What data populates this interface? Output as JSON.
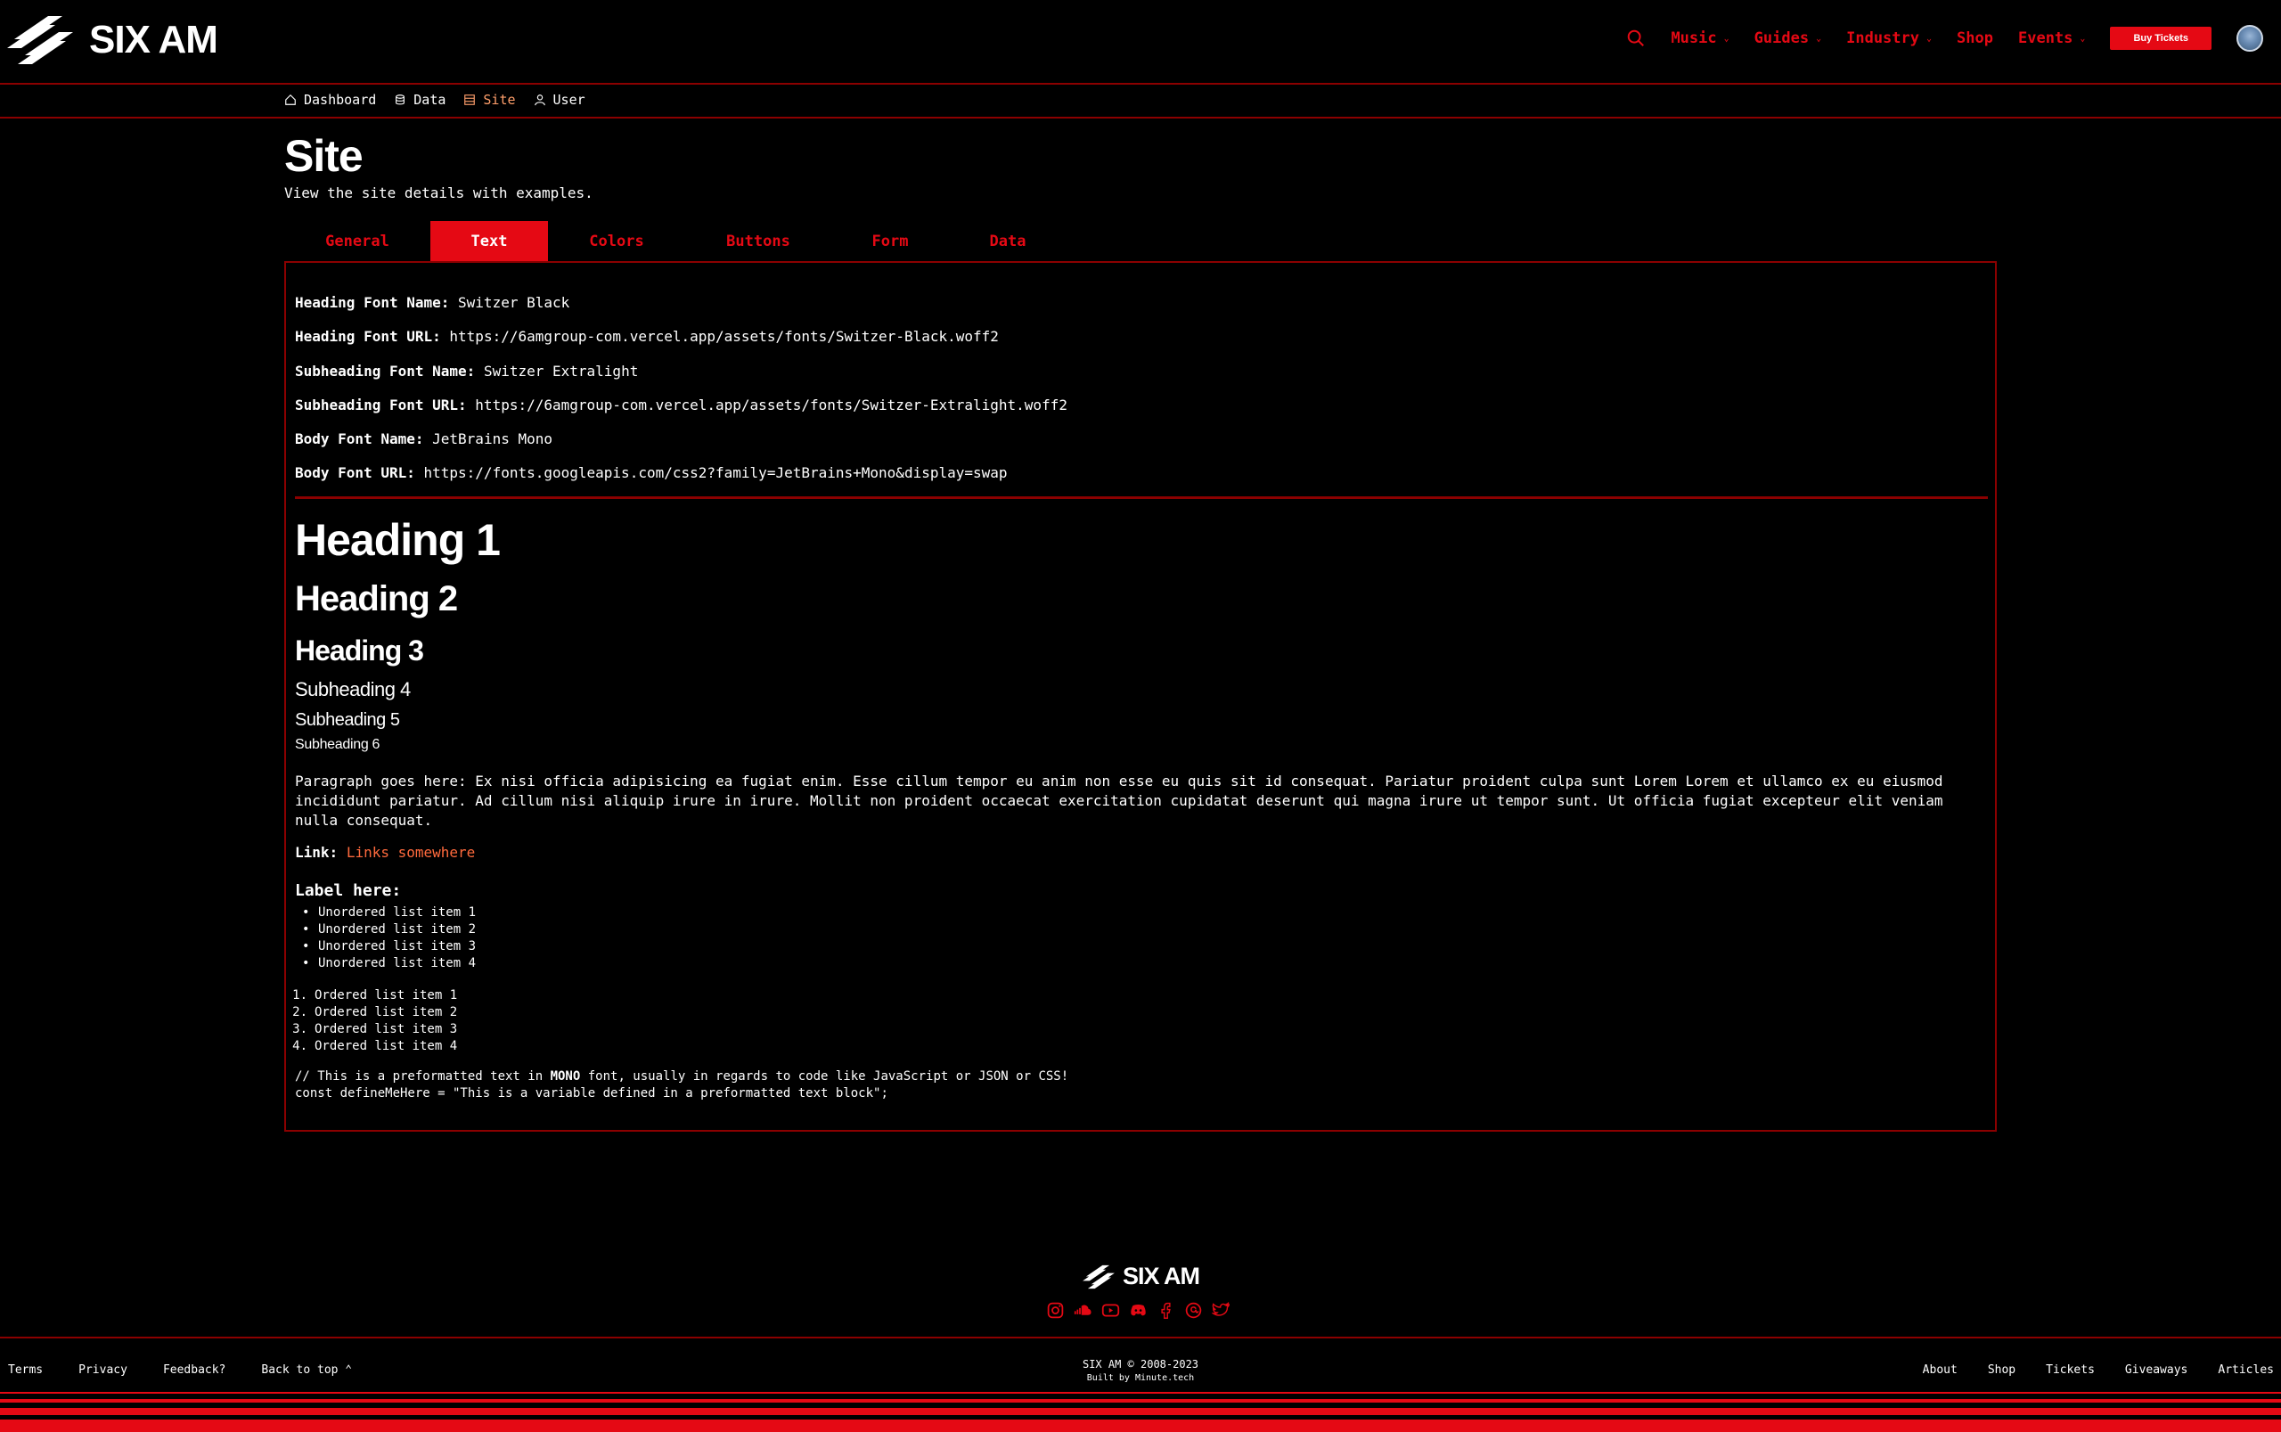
{
  "brand": {
    "name": "SIX AM",
    "accent": "#e50914",
    "border": "#8b0000",
    "link": "#ff6a3d"
  },
  "nav": {
    "search_icon": "search-icon",
    "items": [
      {
        "label": "Music",
        "caret": "⌄"
      },
      {
        "label": "Guides",
        "caret": "⌄"
      },
      {
        "label": "Industry",
        "caret": "⌄"
      },
      {
        "label": "Shop"
      },
      {
        "label": "Events",
        "caret": "⌄"
      }
    ],
    "buy_label": "Buy Tickets"
  },
  "breadcrumb": [
    {
      "label": "Dashboard",
      "icon": "home-icon"
    },
    {
      "label": "Data",
      "icon": "database-icon"
    },
    {
      "label": "Site",
      "icon": "layout-icon"
    },
    {
      "label": "User",
      "icon": "user-icon"
    }
  ],
  "page": {
    "title": "Site",
    "subtitle": "View the site details with examples."
  },
  "tabs": [
    {
      "label": "General"
    },
    {
      "label": "Text"
    },
    {
      "label": "Colors"
    },
    {
      "label": "Buttons"
    },
    {
      "label": "Form"
    },
    {
      "label": "Data"
    }
  ],
  "fonts": [
    {
      "key": "Heading Font Name:",
      "value": "Switzer Black"
    },
    {
      "key": "Heading Font URL:",
      "value": "https://6amgroup-com.vercel.app/assets/fonts/Switzer-Black.woff2"
    },
    {
      "key": "Subheading Font Name:",
      "value": "Switzer Extralight"
    },
    {
      "key": "Subheading Font URL:",
      "value": "https://6amgroup-com.vercel.app/assets/fonts/Switzer-Extralight.woff2"
    },
    {
      "key": "Body Font Name:",
      "value": "JetBrains Mono"
    },
    {
      "key": "Body Font URL:",
      "value": "https://fonts.googleapis.com/css2?family=JetBrains+Mono&display=swap"
    }
  ],
  "samples": {
    "h1": "Heading 1",
    "h2": "Heading 2",
    "h3": "Heading 3",
    "sh4": "Subheading 4",
    "sh5": "Subheading 5",
    "sh6": "Subheading 6",
    "paragraph": "Paragraph goes here: Ex nisi officia adipisicing ea fugiat enim. Esse cillum tempor eu anim non esse eu quis sit id consequat. Pariatur proident culpa sunt Lorem Lorem et ullamco ex eu eiusmod incididunt pariatur. Ad cillum nisi aliquip irure in irure. Mollit non proident occaecat exercitation cupidatat deserunt qui magna irure ut tempor sunt. Ut officia fugiat excepteur elit veniam nulla consequat.",
    "link_key": "Link:",
    "link_text": "Links somewhere",
    "label": "Label here:",
    "ul": [
      "Unordered list item 1",
      "Unordered list item 2",
      "Unordered list item 3",
      "Unordered list item 4"
    ],
    "ol": [
      {
        "num": "1.",
        "text": "Ordered list item 1"
      },
      {
        "num": "2.",
        "text": "Ordered list item 2"
      },
      {
        "num": "3.",
        "text": "Ordered list item 3"
      },
      {
        "num": "4.",
        "text": "Ordered list item 4"
      }
    ],
    "pre_line1_a": "// This is a preformatted text in ",
    "pre_line1_b": "MONO",
    "pre_line1_c": " font, usually in regards to code like JavaScript or JSON or CSS!",
    "pre_line2": "const defineMeHere = \"This is a variable defined in a preformatted text block\";"
  },
  "footer": {
    "brand": "SIX AM",
    "socials": [
      "instagram-icon",
      "soundcloud-icon",
      "youtube-icon",
      "discord-icon",
      "facebook-icon",
      "threads-icon",
      "twitter-icon"
    ],
    "left": [
      {
        "label": "Terms"
      },
      {
        "label": "Privacy"
      },
      {
        "label": "Feedback?"
      },
      {
        "label": "Back to top ⌃"
      }
    ],
    "copyright": "SIX AM © 2008-2023",
    "built_by": "Built by Minute.tech",
    "right": [
      {
        "label": "About"
      },
      {
        "label": "Shop"
      },
      {
        "label": "Tickets"
      },
      {
        "label": "Giveaways"
      },
      {
        "label": "Articles"
      }
    ]
  }
}
